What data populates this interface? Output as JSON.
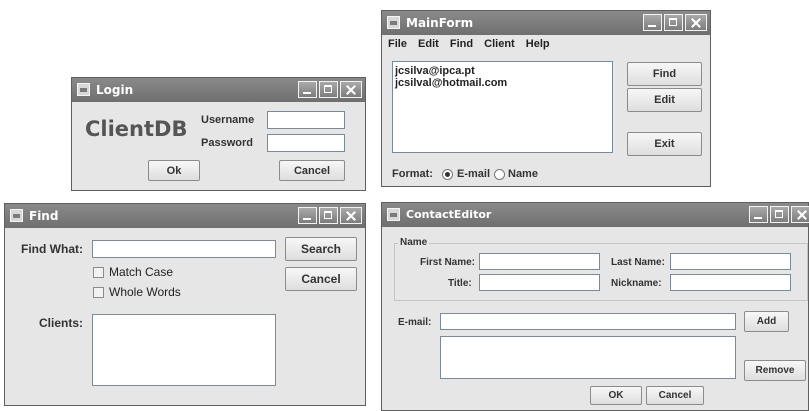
{
  "main_form": {
    "title": "MainForm",
    "menu": [
      "File",
      "Edit",
      "Find",
      "Client",
      "Help"
    ],
    "list_items": [
      "jcsilva@ipca.pt",
      "jcsilval@hotmail.com"
    ],
    "buttons": {
      "find": "Find",
      "edit": "Edit",
      "exit": "Exit"
    },
    "format_label": "Format:",
    "format_options": [
      "E-mail",
      "Name"
    ],
    "format_selected": "E-mail"
  },
  "login": {
    "title": "Login",
    "logo": "ClientDB",
    "username_label": "Username",
    "password_label": "Password",
    "ok_label": "Ok",
    "cancel_label": "Cancel"
  },
  "find": {
    "title": "Find",
    "find_what_label": "Find What:",
    "match_case_label": "Match Case",
    "whole_words_label": "Whole Words",
    "clients_label": "Clients:",
    "search_label": "Search",
    "cancel_label": "Cancel"
  },
  "contact_editor": {
    "title": "ContactEditor",
    "group_label": "Name",
    "first_name_label": "First Name:",
    "last_name_label": "Last Name:",
    "title_label": "Title:",
    "nickname_label": "Nickname:",
    "email_label": "E-mail:",
    "add_label": "Add",
    "remove_label": "Remove",
    "ok_label": "OK",
    "cancel_label": "Cancel"
  }
}
